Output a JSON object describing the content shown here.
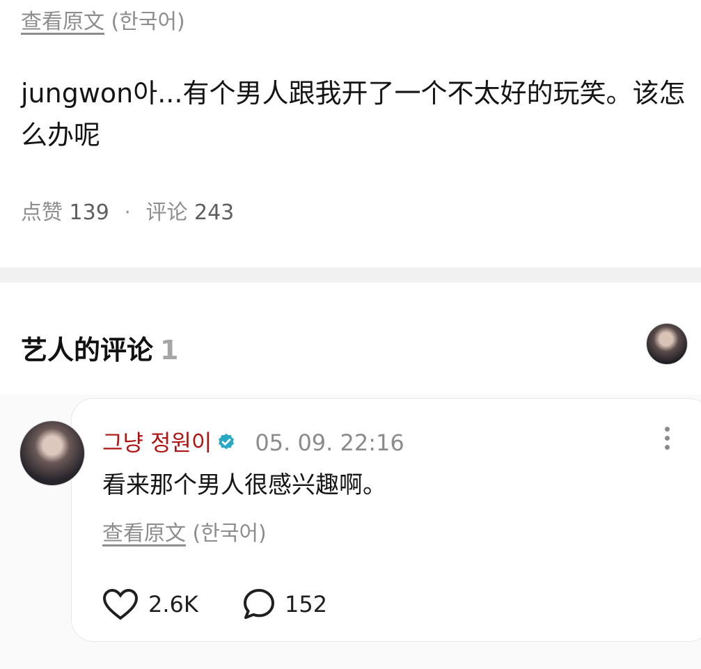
{
  "post": {
    "view_original": {
      "link": "查看原文",
      "lang": "(한국어)"
    },
    "text": "jungwon아...有个男人跟我开了一个不太好的玩笑。该怎么办呢",
    "stats": {
      "likes_label": "点赞",
      "likes": "139",
      "separator": "·",
      "comments_label": "评论",
      "comments": "243"
    }
  },
  "artist_comments": {
    "title": "艺人的评论",
    "count": "1",
    "comment": {
      "author": "그냥 정원이",
      "timestamp": "05. 09. 22:16",
      "text": "看来那个男人很感兴趣啊。",
      "view_original": {
        "link": "查看原文",
        "lang": "(한국어)"
      },
      "likes": "2.6K",
      "replies": "152"
    }
  },
  "colors": {
    "author_name": "#b31212",
    "verified_badge": "#2aa9c4",
    "muted_text": "#8d8d8d"
  },
  "icons": [
    "verified-badge-icon",
    "more-vertical-icon",
    "heart-icon",
    "comment-bubble-icon"
  ]
}
